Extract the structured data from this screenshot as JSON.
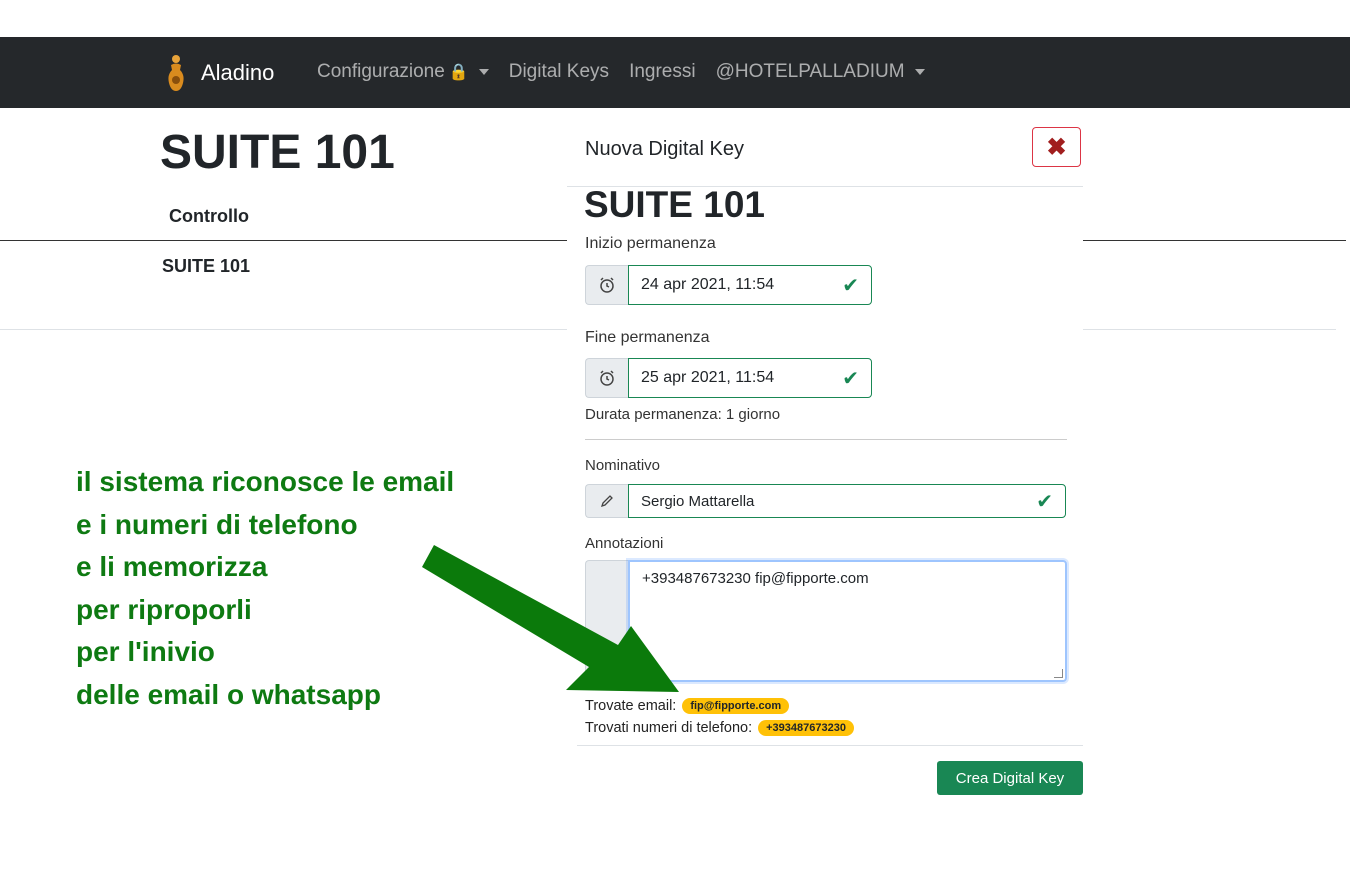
{
  "navbar": {
    "brand": "Aladino",
    "items": [
      {
        "label": "Configurazione",
        "has_lock": true,
        "has_caret": true
      },
      {
        "label": "Digital Keys",
        "has_lock": false,
        "has_caret": false
      },
      {
        "label": "Ingressi",
        "has_lock": false,
        "has_caret": false
      },
      {
        "label": "@HOTELPALLADIUM",
        "has_lock": false,
        "has_caret": true
      }
    ],
    "lock_icon": "🔒"
  },
  "page": {
    "title": "SUITE 101",
    "table_header": "Controllo",
    "table_cell": "SUITE 101"
  },
  "modal": {
    "title": "Nuova Digital Key",
    "close_icon": "✖",
    "room": "SUITE 101",
    "start_label": "Inizio permanenza",
    "start_value": "24 apr 2021, 11:54",
    "end_label": "Fine permanenza",
    "end_value": "25 apr 2021, 11:54",
    "duration": "Durata permanenza: 1 giorno",
    "name_label": "Nominativo",
    "name_value": "Sergio Mattarella",
    "notes_label": "Annotazioni",
    "notes_value": "+393487673230 fip@fipporte.com",
    "found_email_label": "Trovate email:",
    "found_email": "fip@fipporte.com",
    "found_phone_label": "Trovati numeri di telefono:",
    "found_phone": "+393487673230",
    "submit": "Crea Digital Key",
    "check_icon": "✔"
  },
  "annotation": {
    "lines": [
      "il sistema riconosce le email",
      "e i numeri di telefono",
      "e li memorizza",
      "per riproporli",
      "per l'inivio",
      "delle email o whatsapp"
    ],
    "color": "#0e7a12"
  }
}
